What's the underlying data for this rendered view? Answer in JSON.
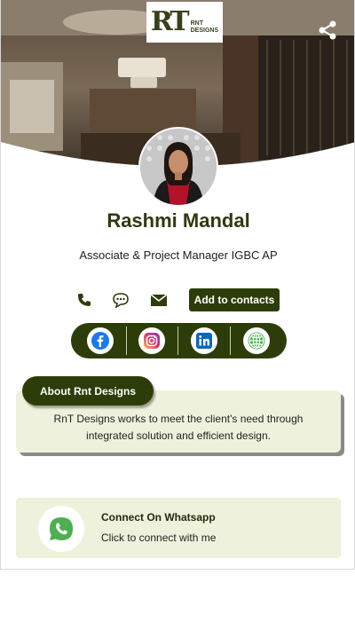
{
  "header": {
    "logo_mark": "RT",
    "logo_word_1": "RNT",
    "logo_word_2": "DESIGNS",
    "share_icon": "share-icon"
  },
  "profile": {
    "name": "Rashmi Mandal",
    "title": "Associate & Project Manager IGBC AP"
  },
  "actions": {
    "icons": [
      "phone-icon",
      "chat-icon",
      "email-icon"
    ],
    "add_contact_label": "Add to contacts"
  },
  "social": {
    "items": [
      "facebook-icon",
      "instagram-icon",
      "linkedin-icon",
      "globe-icon"
    ]
  },
  "about": {
    "heading": "About Rnt Designs",
    "text": "RnT Designs works to meet the client's need through integrated solution and efficient design."
  },
  "whatsapp": {
    "title": "Connect On Whatsapp",
    "subtitle": "Click to connect with me"
  },
  "colors": {
    "primary": "#2d3d0a",
    "panel": "#eef2dc",
    "name_text": "#2f3a12"
  }
}
